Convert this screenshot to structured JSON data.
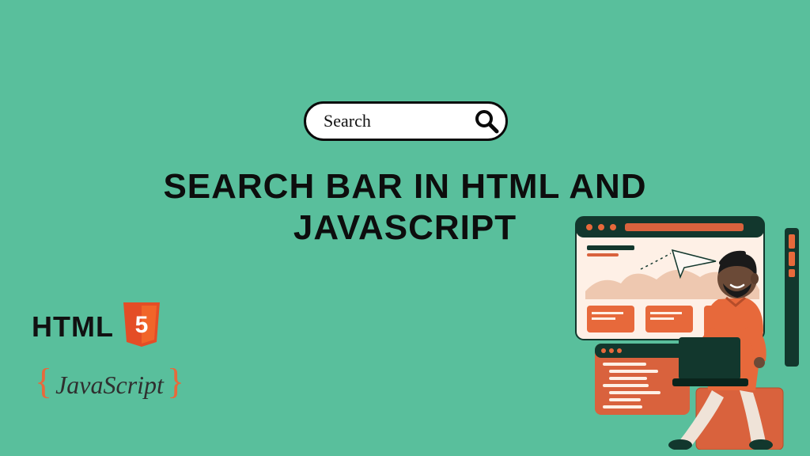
{
  "search": {
    "placeholder": "Search"
  },
  "title": "SEARCH BAR IN HTML AND JAVASCRIPT",
  "badges": {
    "html_text": "HTML",
    "html_version": "5",
    "js_text": "JavaScript",
    "brace_open": "{",
    "brace_close": "}"
  },
  "colors": {
    "bg": "#59bf9c",
    "accent_orange": "#e7693b",
    "dark": "#0d0d0d"
  }
}
